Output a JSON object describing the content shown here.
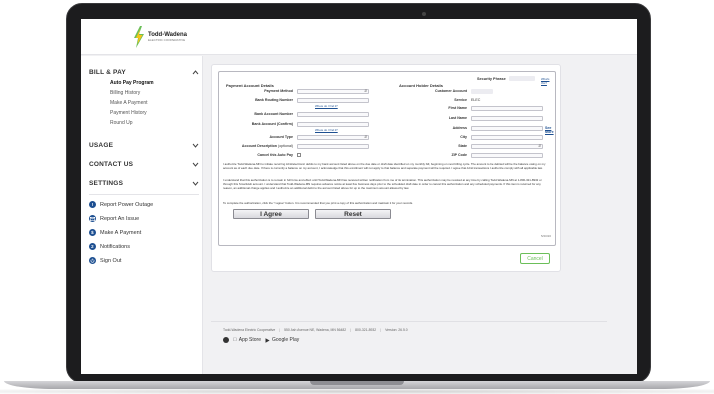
{
  "brand": {
    "name": "Todd-Wadena",
    "tagline": "ELECTRIC COOPERATIVE"
  },
  "sidebar": {
    "sections": [
      {
        "title": "BILL & PAY",
        "items": [
          "Auto Pay Program",
          "Billing History",
          "Make A Payment",
          "Payment History",
          "Round Up"
        ],
        "active": "Auto Pay Program"
      },
      {
        "title": "USAGE"
      },
      {
        "title": "CONTACT US"
      },
      {
        "title": "SETTINGS"
      }
    ],
    "actions": [
      {
        "label": "Report Power Outage",
        "icon": "warning-icon"
      },
      {
        "label": "Report An Issue",
        "icon": "mail-icon"
      },
      {
        "label": "Make A Payment",
        "icon": "dollar-icon"
      },
      {
        "label": "Notifications",
        "icon": "bell-icon"
      },
      {
        "label": "Sign Out",
        "icon": "power-icon"
      }
    ]
  },
  "form": {
    "security_phrase_label": "Security Phrase",
    "whats_this": "What's this?",
    "payment_header": "Payment Account Details",
    "holder_header": "Account Holder Details",
    "payment_fields": {
      "payment_method": "Payment Method",
      "routing_number": "Bank Routing Number",
      "where_1": "Where do I find it?",
      "account_number": "Bank Account Number",
      "account_confirm": "Bank Account (Confirm)",
      "where_2": "Where do I find it?",
      "account_type": "Account Type",
      "account_description": "Account Description",
      "optional": "(optional)",
      "cancel_auto_pay": "Cancel this Auto Pay"
    },
    "holder_fields": {
      "customer_account": "Customer Account",
      "service": "Service",
      "service_value": "ELEC",
      "first_name": "First Name",
      "last_name": "Last Name",
      "address": "Address",
      "see_more": "See More",
      "city": "City",
      "state": "State",
      "zip": "ZIP Code"
    },
    "legal_1": "I authorize Todd-Wadena-MN to initiate recurring ACH/electronic debits to my bank account listed above on the due date or draft date identified on my monthly bill, beginning on next billing cycle. The amount to be debited will be the balance owing on my account as of each due date. If there is currently a balance on my account, I acknowledge that this enrollment will not apply to that balance and separate payment will be required. I agree that ACH transactions I authorize comply with all applicable law.",
    "legal_2": "I understand that this authorization is to remain in full force and effect until Todd-Wadena-MN has received written notification from me of its termination. This authorization may be revoked at any time by calling Todd-Wadena-MN at 1-800-321-8932 or through this SmartHub account. I understand that Todd-Wadena-MN requires advance notice at least five business days prior to the scheduled draft date in order to cancel this authorization and any scheduled payments. If this item is returned for any reason, an additional charge applies and I authorize an additional debit to the account listed above for up to the maximum amount allowed by law.",
    "legal_3": "To complete the authorization, click the \"I agree\" button. It is recommended that you print a copy of this authorization and maintain it for your records.",
    "agree_label": "I Agree",
    "reset_label": "Reset",
    "version": "5/20/20",
    "cancel_label": "Cancel"
  },
  "footer": {
    "coop": "Todd-Wadena Electric Cooperative",
    "address": "550 Ash Avenue NE, Wadena, MN 56482",
    "phone": "800-321-8932",
    "version": "Version: 26.5.0",
    "app_store": "App Store",
    "google_play": "Google Play"
  },
  "colors": {
    "brand_green": "#6bbf59",
    "brand_blue": "#1d4f91",
    "logo_yellow": "#f5c518"
  }
}
